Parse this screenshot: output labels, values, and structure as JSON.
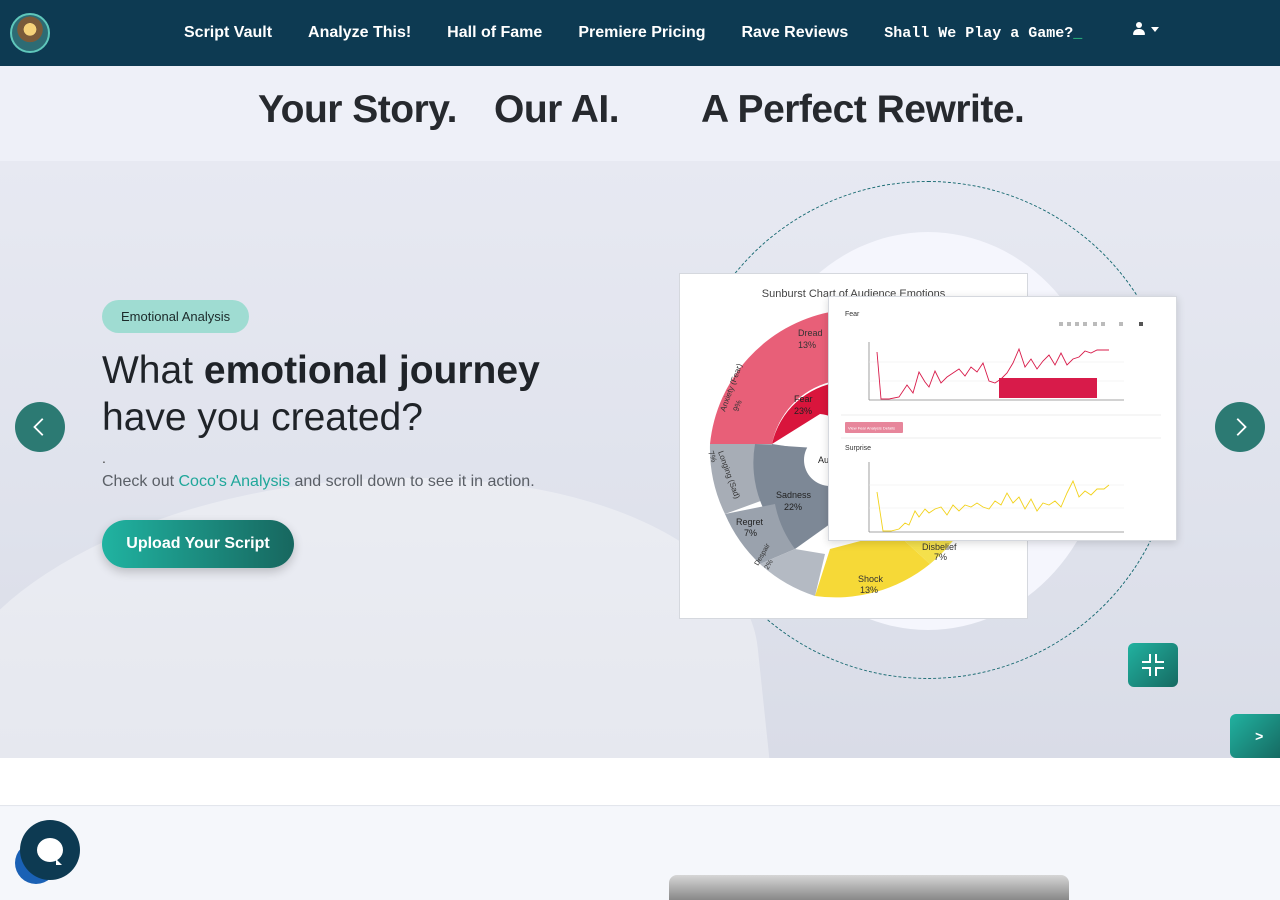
{
  "nav": {
    "items": [
      "Script Vault",
      "Analyze This!",
      "Hall of Fame",
      "Premiere Pricing",
      "Rave Reviews"
    ],
    "game_label": "Shall We Play a Game?",
    "game_cursor": "_"
  },
  "tagline": {
    "part1": "Your Story.",
    "part2": "Our AI.",
    "part3": "A Perfect Rewrite."
  },
  "hero": {
    "badge": "Emotional Analysis",
    "headline_plain": "What",
    "headline_bold": "emotional journey",
    "headline_line2": "have you created?",
    "dot": ".",
    "sub_before": "Check out",
    "sub_link": "Coco's Analysis",
    "sub_after": "and scroll down to see it in action.",
    "cta": "Upload Your Script",
    "side_tab": ">"
  },
  "sunburst": {
    "title": "Sunburst Chart of Audience Emotions",
    "center_label": "Au",
    "labels": [
      {
        "name": "Dread",
        "pct": "13%"
      },
      {
        "name": "Anxiety (Fear)",
        "pct": "9%"
      },
      {
        "name": "Fear",
        "pct": "23%"
      },
      {
        "name": "Longing (Sad)",
        "pct": "7%"
      },
      {
        "name": "Sadness",
        "pct": "22%"
      },
      {
        "name": "Regret",
        "pct": "7%"
      },
      {
        "name": "Despair",
        "pct": "2%"
      },
      {
        "name": "Disbelief",
        "pct": "7%"
      },
      {
        "name": "Shock",
        "pct": "13%"
      }
    ]
  },
  "line_charts": {
    "fear_title": "Fear",
    "fear_button": "View Fear Analysis Details",
    "surprise_title": "Surprise",
    "fear_color": "#d81b4a",
    "surprise_color": "#f2d21b"
  },
  "colors": {
    "nav_bg": "#0d3a52",
    "accent": "#1fa79a",
    "badge_bg": "#9fdcd2"
  }
}
